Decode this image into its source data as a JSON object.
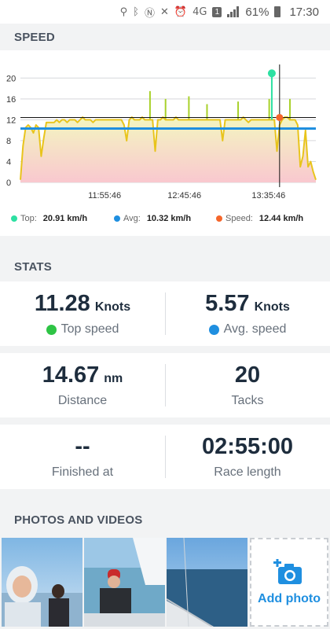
{
  "status_bar": {
    "battery_pct": "61%",
    "time": "17:30",
    "sim": "1",
    "network": "4G"
  },
  "speed_section": {
    "title": "SPEED"
  },
  "chart_data": {
    "type": "line",
    "x": [
      "11:55:46",
      "12:45:46",
      "13:35:46"
    ],
    "ylim": [
      0,
      22
    ],
    "yticks": [
      "0",
      "4",
      "8",
      "12",
      "16",
      "20"
    ],
    "grid": true,
    "avg_line": 10.32,
    "cursor_value": 12.44,
    "top_value": 20.91,
    "colors": {
      "line": "#e8c41c",
      "avg": "#1f8fe0",
      "top": "#2de0a2",
      "cursor": "#f5662b",
      "fill_top": "#f3f6c0",
      "fill_bottom": "#f9c8cf"
    },
    "series_values": [
      0.5,
      7,
      10.5,
      11,
      10.5,
      9.5,
      11,
      10.5,
      5,
      8.5,
      11.5,
      11.5,
      11.5,
      11.5,
      12,
      11.5,
      12,
      12,
      11.5,
      12,
      12,
      12,
      11.5,
      12,
      12.5,
      12,
      12,
      12,
      11.5,
      12,
      12,
      12,
      12,
      12,
      12,
      12,
      12,
      12,
      12,
      12,
      11,
      8,
      12,
      12.5,
      12,
      12,
      12,
      12.5,
      12,
      12,
      12,
      12,
      6,
      12,
      12,
      12.5,
      12,
      12,
      12,
      12,
      12.5,
      12,
      12,
      12,
      12,
      12,
      12,
      12,
      12,
      12,
      12,
      12,
      12,
      12,
      12,
      12,
      12,
      12,
      8,
      12,
      12,
      12,
      12,
      12,
      12,
      12,
      12.5,
      12,
      11.5,
      12,
      12,
      12,
      12,
      12,
      12,
      12,
      12,
      12,
      12,
      6,
      11,
      12,
      12.5,
      12.5,
      12,
      12,
      12,
      11,
      3,
      5,
      10,
      3,
      4,
      2,
      0.5
    ]
  },
  "legend": {
    "top_label": "Top:",
    "top_value": "20.91 km/h",
    "avg_label": "Avg:",
    "avg_value": "10.32 km/h",
    "speed_label": "Speed:",
    "speed_value": "12.44 km/h"
  },
  "stats_section": {
    "title": "STATS"
  },
  "stats": {
    "top_speed_value": "11.28",
    "top_speed_unit": "Knots",
    "top_speed_label": "Top speed",
    "avg_speed_value": "5.57",
    "avg_speed_unit": "Knots",
    "avg_speed_label": "Avg. speed",
    "distance_value": "14.67",
    "distance_unit": "nm",
    "distance_label": "Distance",
    "tacks_value": "20",
    "tacks_label": "Tacks",
    "finished_value": "--",
    "finished_label": "Finished at",
    "race_length_value": "02:55:00",
    "race_length_label": "Race length"
  },
  "photos_section": {
    "title": "PHOTOS AND VIDEOS",
    "add_label": "Add photo"
  }
}
